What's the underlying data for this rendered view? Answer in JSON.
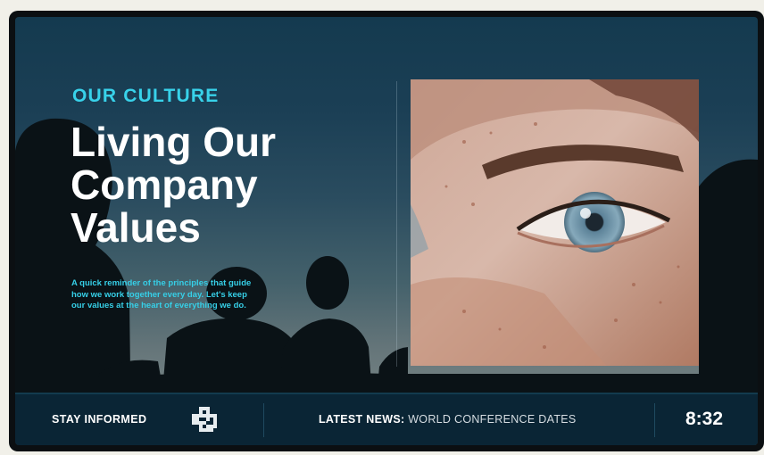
{
  "hero": {
    "eyebrow": "OUR CULTURE",
    "headline_lines": [
      "Living Our",
      "Company",
      "Values"
    ],
    "description_lines": [
      "A quick reminder of the principles that guide",
      "how we work together every day. Let's keep",
      "our values at the heart of everything we do."
    ]
  },
  "ticker": {
    "stay_label": "STAY INFORMED",
    "news_label": "LATEST NEWS:",
    "news_text": "WORLD CONFERENCE DATES",
    "time": "8:32"
  },
  "icons": {
    "qr": "qr-code-icon"
  },
  "colors": {
    "accent": "#38d2ea",
    "bar_background": "#0a2535",
    "headline": "#ffffff"
  }
}
